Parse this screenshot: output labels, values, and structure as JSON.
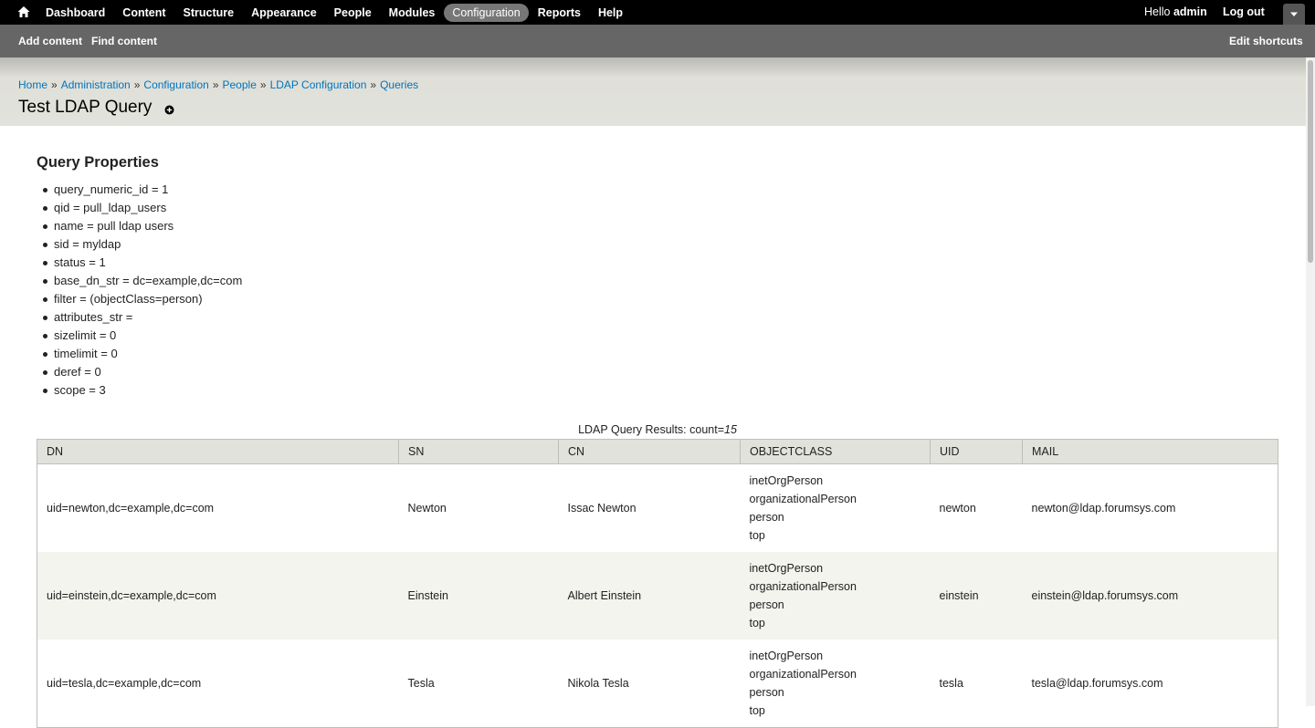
{
  "toolbar": {
    "menu": [
      "Dashboard",
      "Content",
      "Structure",
      "Appearance",
      "People",
      "Modules",
      "Configuration",
      "Reports",
      "Help"
    ],
    "active_item": "Configuration",
    "greeting": "Hello ",
    "username": "admin",
    "logout": "Log out",
    "icons": {
      "home": "home-icon",
      "toggle": "chevron-down-icon"
    }
  },
  "shortcuts": {
    "add_content": "Add content",
    "find_content": "Find content",
    "edit_shortcuts": "Edit shortcuts"
  },
  "breadcrumb": [
    "Home",
    "Administration",
    "Configuration",
    "People",
    "LDAP Configuration",
    "Queries"
  ],
  "breadcrumb_separator": "»",
  "page": {
    "title": "Test LDAP Query"
  },
  "query_properties": {
    "title": "Query Properties",
    "items": [
      "query_numeric_id = 1",
      "qid = pull_ldap_users",
      "name = pull ldap users",
      "sid = myldap",
      "status = 1",
      "base_dn_str = dc=example,dc=com",
      "filter = (objectClass=person)",
      "attributes_str =",
      "sizelimit = 0",
      "timelimit = 0",
      "deref = 0",
      "scope = 3"
    ]
  },
  "results": {
    "caption_prefix": "LDAP Query Results: count=",
    "count": "15",
    "columns": [
      "DN",
      "SN",
      "CN",
      "OBJECTCLASS",
      "UID",
      "MAIL"
    ],
    "rows": [
      {
        "dn": "uid=newton,dc=example,dc=com",
        "sn": "Newton",
        "cn": "Issac Newton",
        "objectclass": [
          "inetOrgPerson",
          "organizationalPerson",
          "person",
          "top"
        ],
        "uid": "newton",
        "mail": "newton@ldap.forumsys.com"
      },
      {
        "dn": "uid=einstein,dc=example,dc=com",
        "sn": "Einstein",
        "cn": "Albert Einstein",
        "objectclass": [
          "inetOrgPerson",
          "organizationalPerson",
          "person",
          "top"
        ],
        "uid": "einstein",
        "mail": "einstein@ldap.forumsys.com"
      },
      {
        "dn": "uid=tesla,dc=example,dc=com",
        "sn": "Tesla",
        "cn": "Nikola Tesla",
        "objectclass": [
          "inetOrgPerson",
          "organizationalPerson",
          "person",
          "top"
        ],
        "uid": "tesla",
        "mail": "tesla@ldap.forumsys.com"
      }
    ]
  }
}
